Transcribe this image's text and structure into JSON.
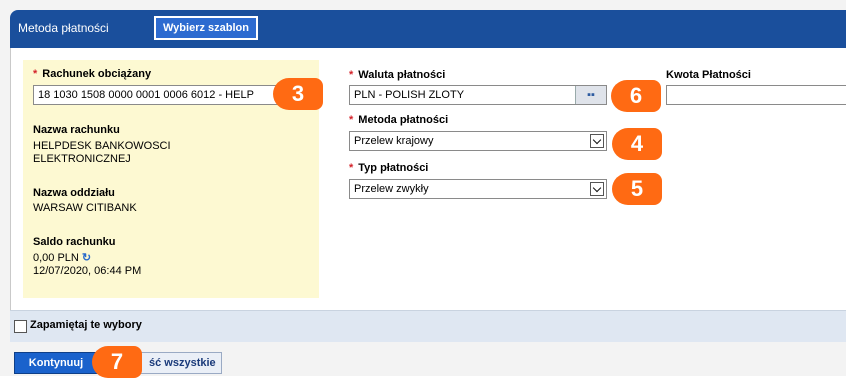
{
  "header": {
    "title": "Metoda płatności",
    "template_button": "Wybierz szablon"
  },
  "account": {
    "charged_label": "Rachunek obciążany",
    "charged_value": "18 1030 1508 0000 0001 0006 6012 - HELP",
    "name_label": "Nazwa rachunku",
    "name_line1": "HELPDESK BANKOWOSCI",
    "name_line2": "ELEKTRONICZNEJ",
    "branch_label": "Nazwa oddziału",
    "branch_value": "WARSAW CITIBANK",
    "balance_label": "Saldo rachunku",
    "balance_value": "0,00 PLN",
    "balance_time": "12/07/2020, 06:44 PM"
  },
  "currency": {
    "label": "Waluta płatności",
    "value": "PLN - POLISH ZLOTY"
  },
  "method": {
    "label": "Metoda płatności",
    "value": "Przelew krajowy"
  },
  "type": {
    "label": "Typ płatności",
    "value": "Przelew zwykły"
  },
  "amount": {
    "label": "Kwota Płatności",
    "value": ""
  },
  "remember": {
    "label": "Zapamiętaj te wybory"
  },
  "buttons": {
    "continue": "Kontynuuj",
    "clear": "ść wszystkie"
  },
  "badges": {
    "b3": "3",
    "b4": "4",
    "b5": "5",
    "b6": "6",
    "b7": "7"
  },
  "colors": {
    "header": "#1a4f9c",
    "badge": "#ff6a13",
    "account_panel": "#fdf9d2",
    "required_star": "#d4232a"
  },
  "icons": {
    "lookup": "binoculars-icon",
    "refresh": "refresh-icon",
    "select": "chevron-down-icon"
  }
}
